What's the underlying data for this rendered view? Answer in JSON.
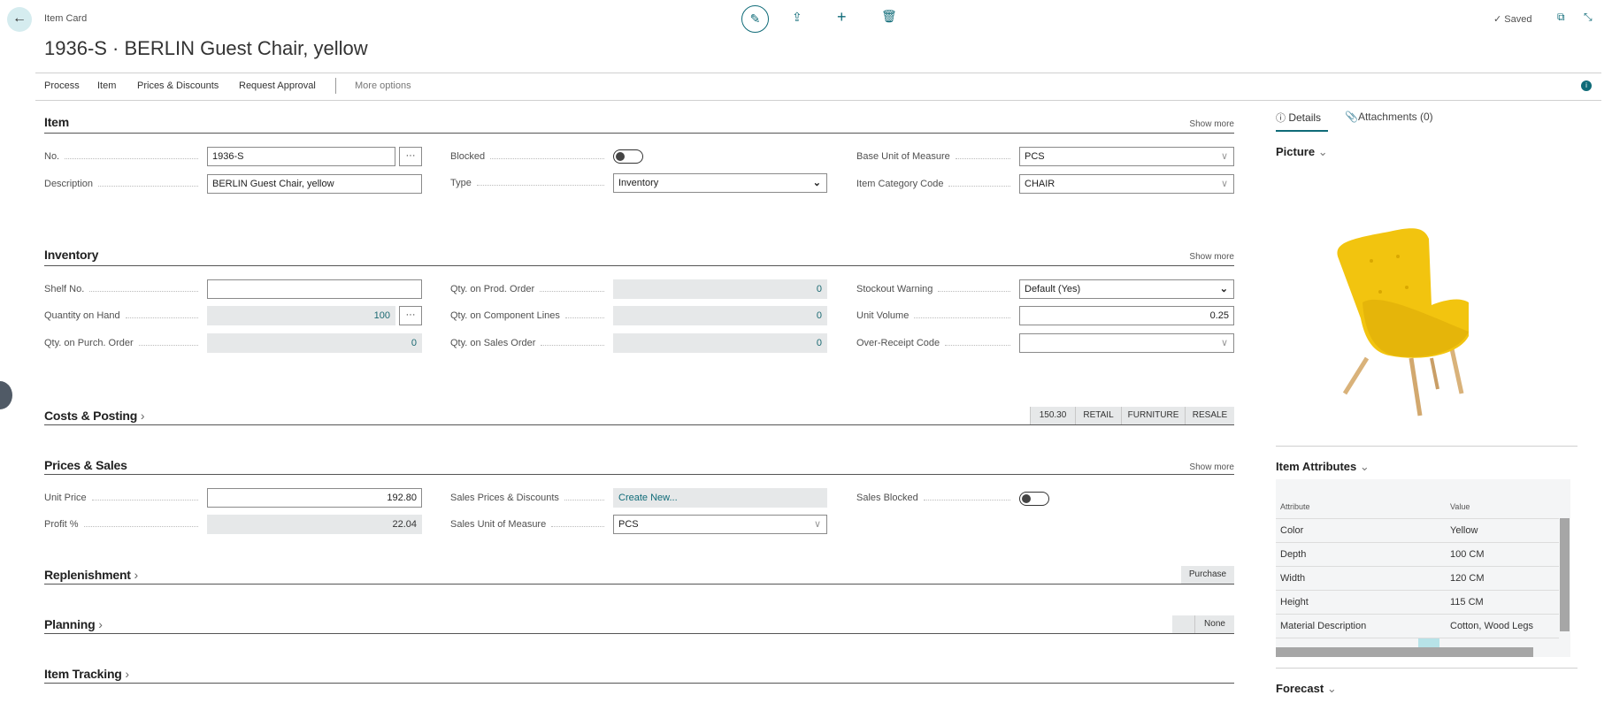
{
  "header": {
    "breadcrumb": "Item Card",
    "title": "1936-S · BERLIN Guest Chair, yellow",
    "saved": "Saved",
    "saved_icon": "✓"
  },
  "actions": [
    "Process",
    "Item",
    "Prices & Discounts",
    "Request Approval",
    "More options"
  ],
  "item": {
    "title": "Item",
    "show_more": "Show more",
    "no_label": "No.",
    "no_value": "1936-S",
    "desc_label": "Description",
    "desc_value": "BERLIN Guest Chair, yellow",
    "blocked_label": "Blocked",
    "blocked": false,
    "type_label": "Type",
    "type_value": "Inventory",
    "base_uom_label": "Base Unit of Measure",
    "base_uom_value": "PCS",
    "cat_label": "Item Category Code",
    "cat_value": "CHAIR"
  },
  "inventory": {
    "title": "Inventory",
    "show_more": "Show more",
    "shelf_label": "Shelf No.",
    "shelf_value": "",
    "qoh_label": "Quantity on Hand",
    "qoh_value": "100",
    "purch_label": "Qty. on Purch. Order",
    "purch_value": "0",
    "prod_label": "Qty. on Prod. Order",
    "prod_value": "0",
    "comp_label": "Qty. on Component Lines",
    "comp_value": "0",
    "sales_label": "Qty. on Sales Order",
    "sales_value": "0",
    "stockout_label": "Stockout Warning",
    "stockout_value": "Default (Yes)",
    "vol_label": "Unit Volume",
    "vol_value": "0.25",
    "orc_label": "Over-Receipt Code",
    "orc_value": ""
  },
  "costs": {
    "title": "Costs & Posting",
    "chips": [
      "150.30",
      "RETAIL",
      "FURNITURE",
      "RESALE"
    ]
  },
  "prices": {
    "title": "Prices & Sales",
    "show_more": "Show more",
    "unit_price_label": "Unit Price",
    "unit_price_value": "192.80",
    "profit_label": "Profit %",
    "profit_value": "22.04",
    "spd_label": "Sales Prices & Discounts",
    "spd_value": "Create New...",
    "suom_label": "Sales Unit of Measure",
    "suom_value": "PCS",
    "sales_blocked_label": "Sales Blocked",
    "sales_blocked": false
  },
  "replenishment": {
    "title": "Replenishment",
    "chip": "Purchase"
  },
  "planning": {
    "title": "Planning",
    "chip": "None"
  },
  "tracking": {
    "title": "Item Tracking"
  },
  "factbox": {
    "tabs": [
      "Details",
      "Attachments (0)"
    ],
    "picture_title": "Picture",
    "attributes_title": "Item Attributes",
    "attr_headers": [
      "Attribute",
      "Value"
    ],
    "attributes": [
      {
        "name": "Color",
        "value": "Yellow"
      },
      {
        "name": "Depth",
        "value": "100 CM"
      },
      {
        "name": "Width",
        "value": "120 CM"
      },
      {
        "name": "Height",
        "value": "115 CM"
      },
      {
        "name": "Material Description",
        "value": "Cotton, Wood Legs"
      }
    ],
    "forecast_title": "Forecast"
  },
  "colors": {
    "accent": "#0f6b78",
    "chair": "#f2c40f"
  }
}
